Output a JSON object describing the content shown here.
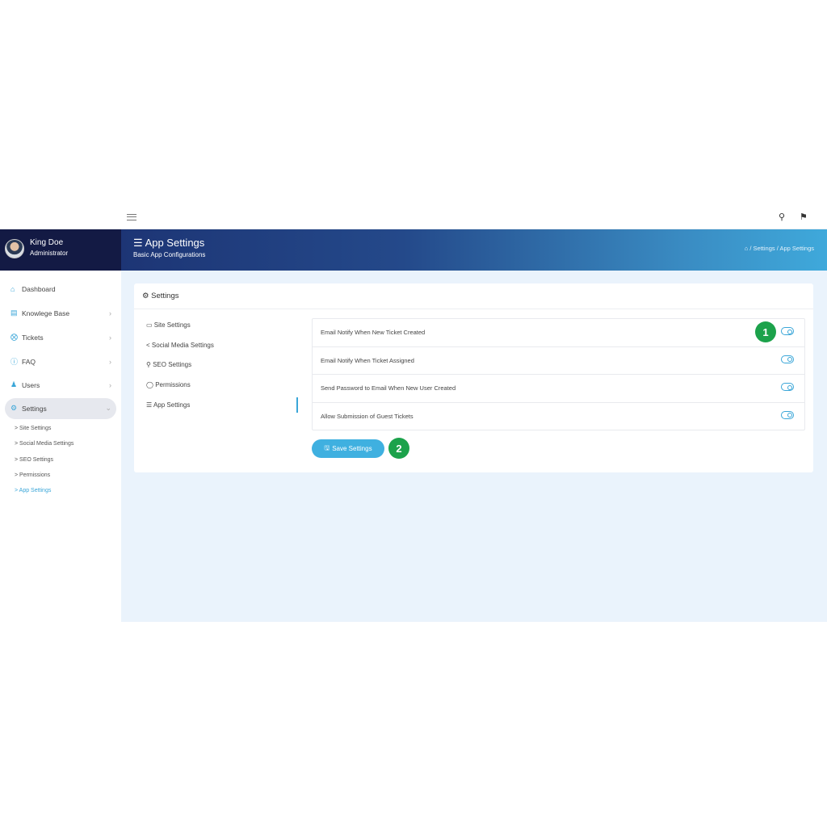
{
  "topbar": {
    "menu_icon": "hamburger-icon",
    "icons": [
      "user-icon",
      "flag-icon"
    ]
  },
  "user": {
    "name": "King Doe",
    "role": "Administrator"
  },
  "page": {
    "title": "App Settings",
    "subtitle": "Basic App Configurations",
    "breadcrumb": [
      "Settings",
      "App Settings"
    ]
  },
  "sidebar": {
    "items": [
      {
        "label": "Dashboard"
      },
      {
        "label": "Knowlege Base"
      },
      {
        "label": "Tickets"
      },
      {
        "label": "FAQ"
      },
      {
        "label": "Users"
      },
      {
        "label": "Settings"
      }
    ],
    "sub_items": [
      {
        "label": "> Site Settings"
      },
      {
        "label": "> Social Media Settings"
      },
      {
        "label": "> SEO Settings"
      },
      {
        "label": "> Permissions"
      },
      {
        "label": "> App Settings"
      }
    ]
  },
  "card": {
    "title": "Settings",
    "nav": [
      {
        "label": "Site Settings"
      },
      {
        "label": "Social Media Settings"
      },
      {
        "label": "SEO Settings"
      },
      {
        "label": "Permissions"
      },
      {
        "label": "App Settings"
      }
    ],
    "options": [
      {
        "label": "Email Notify When New Ticket Created",
        "enabled": true
      },
      {
        "label": "Email Notify When Ticket Assigned",
        "enabled": true
      },
      {
        "label": "Send Password to Email When New User Created",
        "enabled": true
      },
      {
        "label": "Allow Submission of Guest Tickets",
        "enabled": true
      }
    ],
    "save_label": "Save Settings"
  },
  "annotations": [
    "1",
    "2"
  ],
  "colors": {
    "accent": "#3aa6d8",
    "badge": "#1ca24b",
    "sidebar_dark": "#131a44"
  }
}
